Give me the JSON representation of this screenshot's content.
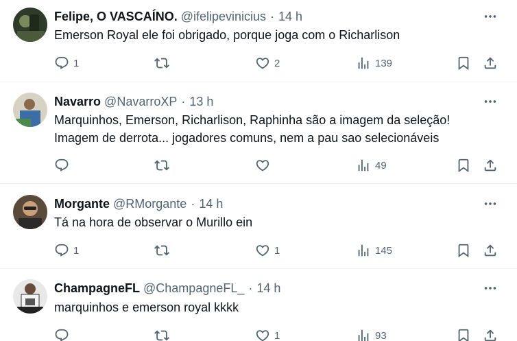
{
  "tweets": [
    {
      "name": "Felipe, O VASCAÍNO.",
      "handle": "@ifelipevinicius",
      "time": "14 h",
      "text": "Emerson Royal ele foi obrigado, porque joga com o Richarlison",
      "replies": "1",
      "retweets": "",
      "likes": "2",
      "views": "139"
    },
    {
      "name": "Navarro",
      "handle": "@NavarroXP",
      "time": "13 h",
      "text": "Marquinhos, Emerson, Richarlison, Raphinha são a imagem da seleção!\nImagem de derrota... jogadores comuns, nem a pau sao selecionáveis",
      "replies": "",
      "retweets": "",
      "likes": "",
      "views": "49"
    },
    {
      "name": "Morgante",
      "handle": "@RMorgante",
      "time": "14 h",
      "text": "Tá na hora de observar o Murillo ein",
      "replies": "1",
      "retweets": "",
      "likes": "1",
      "views": "145"
    },
    {
      "name": "ChampagneFL",
      "handle": "@ChampagneFL_",
      "time": "14 h",
      "text": "marquinhos e emerson royal kkkk",
      "replies": "",
      "retweets": "",
      "likes": "1",
      "views": "93"
    }
  ],
  "separator": "·",
  "icons": {
    "reply": "reply-icon",
    "retweet": "retweet-icon",
    "like": "heart-icon",
    "views": "views-icon",
    "bookmark": "bookmark-icon",
    "share": "share-icon",
    "more": "more-options-icon"
  },
  "colors": {
    "text": "#0f1419",
    "secondary": "#536471",
    "divider": "#eff3f4"
  }
}
